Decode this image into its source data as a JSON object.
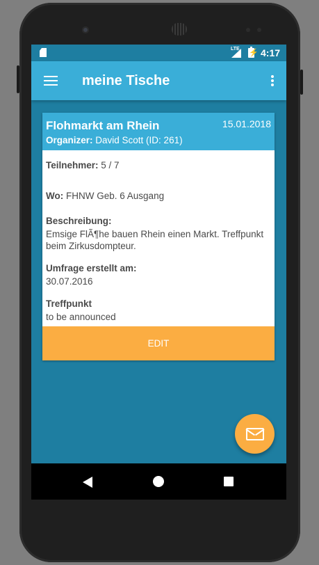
{
  "status_bar": {
    "network": "LTE",
    "time": "4:17"
  },
  "app_bar": {
    "title": "meine Tische"
  },
  "card": {
    "title": "Flohmarkt am Rhein",
    "date": "15.01.2018",
    "organizer_label": "Organizer:",
    "organizer_value": "David Scott (ID: 261)",
    "participants_label": "Teilnehmer:",
    "participants_value": "5 / 7",
    "location_label": "Wo:",
    "location_value": "FHNW Geb. 6 Ausgang",
    "description_label": "Beschreibung:",
    "description_value": "Emsige FlÃ¶he bauen Rhein einen Markt. Treffpunkt beim Zirkusdompteur.",
    "survey_label": "Umfrage erstellt am:",
    "survey_value": "30.07.2016",
    "meeting_point_label": "Treffpunkt",
    "meeting_point_value": "to be announced",
    "edit_label": "EDIT"
  },
  "fab": {
    "icon": "envelope-icon"
  },
  "navigation": {
    "back_icon": "back-icon",
    "home_icon": "home-icon",
    "recents_icon": "recents-icon"
  },
  "colors": {
    "background": "#1e7ea1",
    "app_bar": "#3aaed8",
    "accent": "#fbad42",
    "text": "#4a4a4a"
  }
}
